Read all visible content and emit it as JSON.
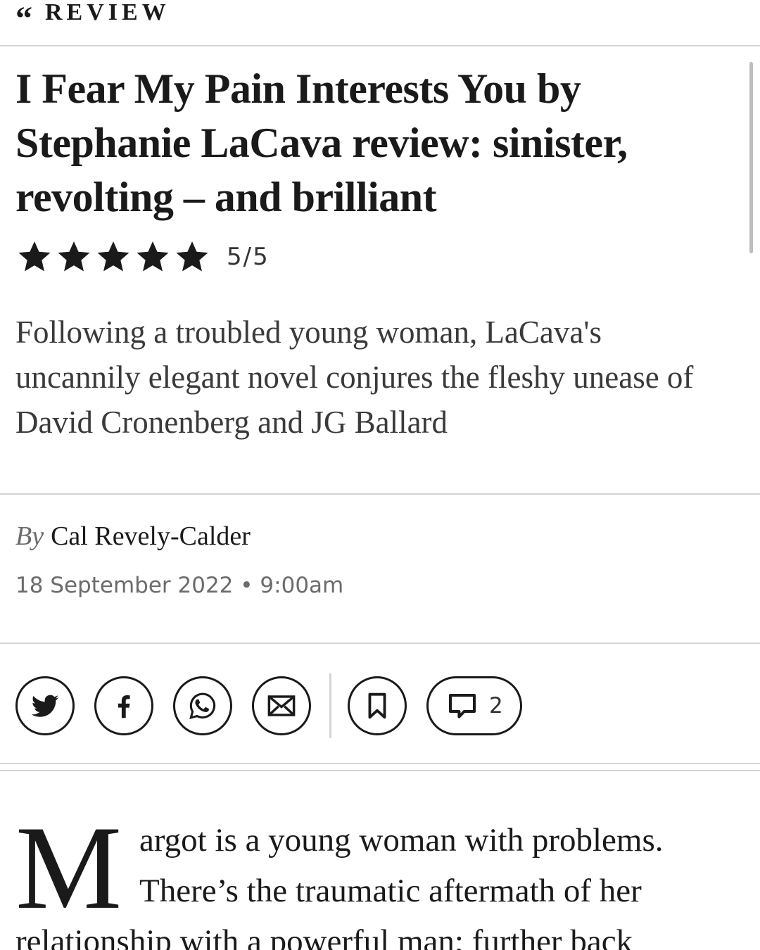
{
  "section": {
    "label": "REVIEW",
    "quote_glyph": "“"
  },
  "article": {
    "headline": "I Fear My Pain Interests You by Stephanie LaCava review: sinister, revolting – and brilliant",
    "rating": {
      "stars": 5,
      "max": 5,
      "text": "5/5"
    },
    "standfirst": "Following a troubled young woman, LaCava's uncannily elegant novel conjures the fleshy unease of David Cronenberg and JG Ballard",
    "byline_prefix": "By",
    "author": "Cal Revely-Calder",
    "date": "18 September 2022",
    "separator": "•",
    "time": "9:00am",
    "body": {
      "dropcap": "M",
      "line1": "argot is a young woman with problems.",
      "line2": "There’s the traumatic aftermath of her",
      "line3": "relationship with a powerful man; further back"
    }
  },
  "share_bar": {
    "icons": [
      "twitter-icon",
      "facebook-icon",
      "whatsapp-icon",
      "email-icon",
      "bookmark-icon",
      "comment-icon"
    ],
    "comment_count": "2"
  },
  "colors": {
    "text": "#1a1a1a",
    "muted": "#6b6b6b",
    "rule": "#d4d4d4",
    "background": "#ffffff"
  }
}
